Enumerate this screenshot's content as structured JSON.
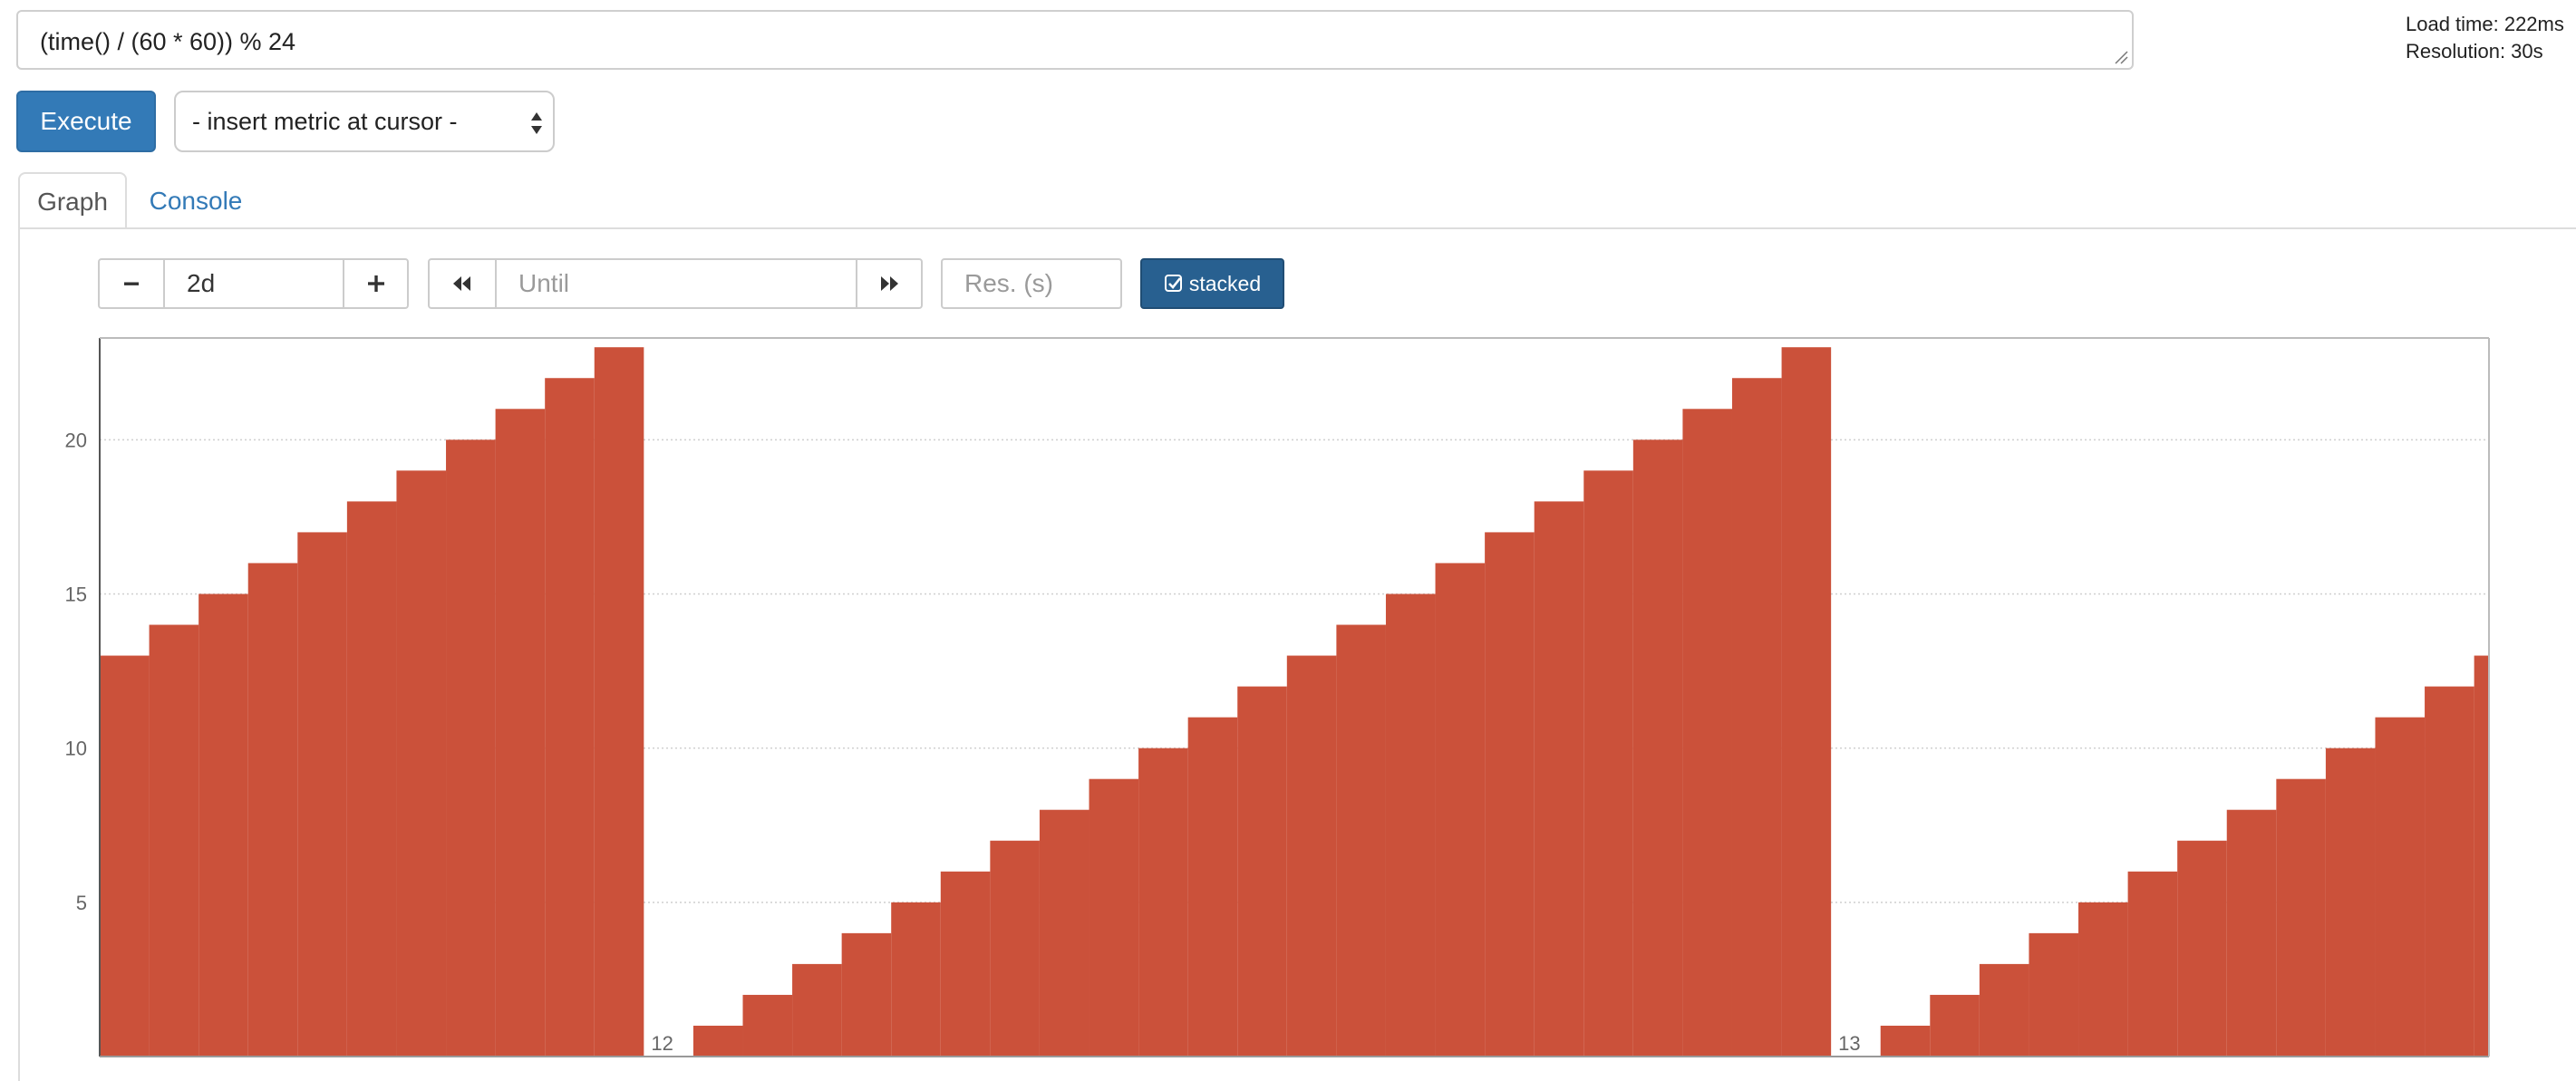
{
  "query": {
    "expression": "(time() / (60 * 60)) % 24"
  },
  "stats": {
    "load_time": "Load time: 222ms",
    "resolution": "Resolution: 30s"
  },
  "toolbar": {
    "execute_label": "Execute",
    "metric_select_value": "- insert metric at cursor -"
  },
  "tabs": [
    {
      "label": "Graph",
      "active": true
    },
    {
      "label": "Console",
      "active": false
    }
  ],
  "graph_controls": {
    "range_decrease_label": "−",
    "range_value": "2d",
    "range_increase_label": "+",
    "until_placeholder": "Until",
    "resolution_placeholder": "Res. (s)",
    "stacked_label": "stacked",
    "icons": [
      "minus-icon",
      "plus-icon",
      "backward-icon",
      "forward-icon",
      "checkbox-checked-icon"
    ]
  },
  "colors": {
    "series": "#cb513a",
    "execute": "#337ab7",
    "stacked": "#286090",
    "link": "#337ab7"
  },
  "chart_data": {
    "type": "area",
    "stacked": true,
    "step": true,
    "grid": true,
    "ylim": [
      0,
      23.3
    ],
    "yticks": [
      5,
      10,
      15,
      20
    ],
    "xticks": [
      {
        "label": "12",
        "x": 24
      },
      {
        "label": "13",
        "x": 48
      }
    ],
    "xlim": [
      13,
      61.3
    ],
    "series": [
      {
        "values": [
          {
            "x": 13,
            "y": 13
          },
          {
            "x": 14,
            "y": 14
          },
          {
            "x": 15,
            "y": 15
          },
          {
            "x": 16,
            "y": 16
          },
          {
            "x": 17,
            "y": 17
          },
          {
            "x": 18,
            "y": 18
          },
          {
            "x": 19,
            "y": 19
          },
          {
            "x": 20,
            "y": 20
          },
          {
            "x": 21,
            "y": 21
          },
          {
            "x": 22,
            "y": 22
          },
          {
            "x": 23,
            "y": 23
          },
          {
            "x": 24,
            "y": 0
          },
          {
            "x": 25,
            "y": 1
          },
          {
            "x": 26,
            "y": 2
          },
          {
            "x": 27,
            "y": 3
          },
          {
            "x": 28,
            "y": 4
          },
          {
            "x": 29,
            "y": 5
          },
          {
            "x": 30,
            "y": 6
          },
          {
            "x": 31,
            "y": 7
          },
          {
            "x": 32,
            "y": 8
          },
          {
            "x": 33,
            "y": 9
          },
          {
            "x": 34,
            "y": 10
          },
          {
            "x": 35,
            "y": 11
          },
          {
            "x": 36,
            "y": 12
          },
          {
            "x": 37,
            "y": 13
          },
          {
            "x": 38,
            "y": 14
          },
          {
            "x": 39,
            "y": 15
          },
          {
            "x": 40,
            "y": 16
          },
          {
            "x": 41,
            "y": 17
          },
          {
            "x": 42,
            "y": 18
          },
          {
            "x": 43,
            "y": 19
          },
          {
            "x": 44,
            "y": 20
          },
          {
            "x": 45,
            "y": 21
          },
          {
            "x": 46,
            "y": 22
          },
          {
            "x": 47,
            "y": 23
          },
          {
            "x": 48,
            "y": 0
          },
          {
            "x": 49,
            "y": 1
          },
          {
            "x": 50,
            "y": 2
          },
          {
            "x": 51,
            "y": 3
          },
          {
            "x": 52,
            "y": 4
          },
          {
            "x": 53,
            "y": 5
          },
          {
            "x": 54,
            "y": 6
          },
          {
            "x": 55,
            "y": 7
          },
          {
            "x": 56,
            "y": 8
          },
          {
            "x": 57,
            "y": 9
          },
          {
            "x": 58,
            "y": 10
          },
          {
            "x": 59,
            "y": 11
          },
          {
            "x": 60,
            "y": 12
          },
          {
            "x": 61,
            "y": 13
          }
        ]
      }
    ]
  }
}
